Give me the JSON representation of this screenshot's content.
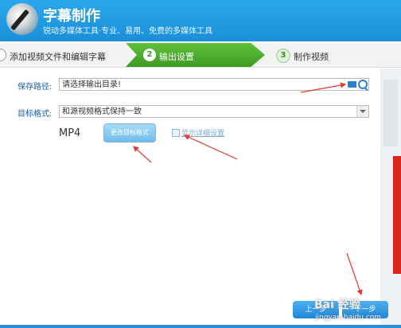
{
  "header": {
    "title": "字幕制作",
    "subtitle": "锐动多媒体工具·专业、易用、免费的多媒体工具"
  },
  "steps": [
    {
      "num": "1",
      "label": "添加视频文件和编辑字幕"
    },
    {
      "num": "2",
      "label": "输出设置"
    },
    {
      "num": "3",
      "label": "制作视频"
    }
  ],
  "form": {
    "save_path_label": "保存路径:",
    "save_path_value": "请选择输出目录!",
    "target_format_label": "目标格式:",
    "target_format_value": "和源视频格式保持一致",
    "format_name": "MP4",
    "change_format_button": "更改目标格式",
    "show_details_label": "显示详细设置"
  },
  "footer": {
    "prev_button": "上一步",
    "next_button": "下一步"
  },
  "watermark": {
    "brand": "Bai 经验",
    "url": "jingyan.baidu.com"
  },
  "colors": {
    "header": "#1b8fd9",
    "active_step": "#3e9b23",
    "label": "#1a5ea3",
    "annotation_arrow": "#e53935"
  }
}
